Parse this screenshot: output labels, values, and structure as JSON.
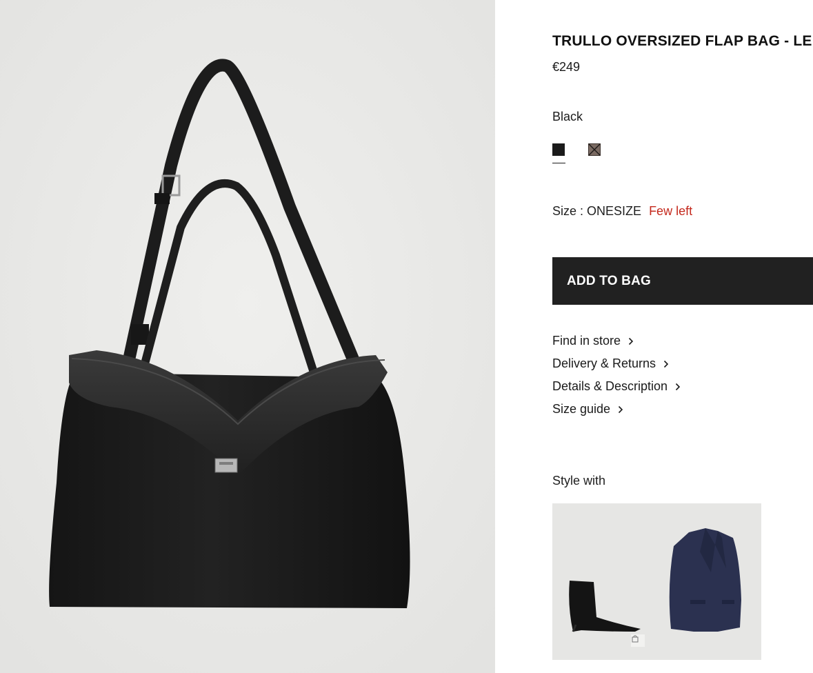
{
  "product": {
    "title": "TRULLO OVERSIZED FLAP BAG - LE",
    "price": "€249",
    "image_icon": "black-leather-flap-bag-photo"
  },
  "color": {
    "selected_label": "Black",
    "swatches": [
      {
        "name": "black",
        "hex": "#1b1b1b",
        "selected": true
      },
      {
        "name": "unavailable",
        "hex": "#7a6a62",
        "selected": false
      }
    ]
  },
  "size": {
    "label": "Size : ONESIZE",
    "stock_note": "Few left",
    "stock_color": "#c4281c"
  },
  "cart": {
    "add_label": "ADD TO BAG",
    "button_color": "#212121"
  },
  "links": [
    {
      "label": "Find in store"
    },
    {
      "label": "Delivery & Returns"
    },
    {
      "label": "Details & Description"
    },
    {
      "label": "Size guide"
    }
  ],
  "style_with": {
    "heading": "Style with",
    "items": [
      {
        "icon": "black-ankle-boot-photo"
      },
      {
        "icon": "navy-coat-photo"
      }
    ],
    "add_icon": "shopping-bag-icon"
  }
}
